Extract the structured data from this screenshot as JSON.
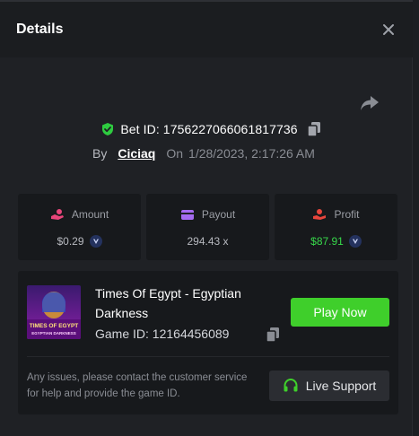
{
  "header": {
    "title": "Details"
  },
  "bet": {
    "id_text": "Bet ID: 1756227066061817736",
    "by_label": "By",
    "username": "Ciciaq",
    "on_label": "On",
    "date": "1/28/2023, 2:17:26 AM"
  },
  "stats": {
    "amount": {
      "label": "Amount",
      "value": "$0.29"
    },
    "payout": {
      "label": "Payout",
      "value": "294.43 x"
    },
    "profit": {
      "label": "Profit",
      "value": "$87.91"
    }
  },
  "game": {
    "name": "Times Of Egypt - Egyptian Darkness",
    "id_text": "Game ID: 12164456089",
    "thumb_title_line1": "TIMES OF EGYPT",
    "thumb_title_line2": "EGYPTIAN DARKNESS",
    "play_label": "Play Now"
  },
  "support": {
    "help_text": "Any issues, please contact the customer service for help and provide the game ID.",
    "button_label": "Live Support"
  },
  "colors": {
    "accent_green": "#3fcf2b",
    "profit_green": "#37d84a",
    "amount_icon": "#e8457a",
    "payout_icon": "#a56bf0",
    "profit_icon": "#e8453c",
    "shield": "#2ecc40"
  },
  "icons": [
    "close-icon",
    "share-icon",
    "shield-check-icon",
    "copy-icon",
    "hand-coins-icon",
    "wallet-icon",
    "user-money-icon",
    "coin-icon",
    "headset-icon"
  ]
}
